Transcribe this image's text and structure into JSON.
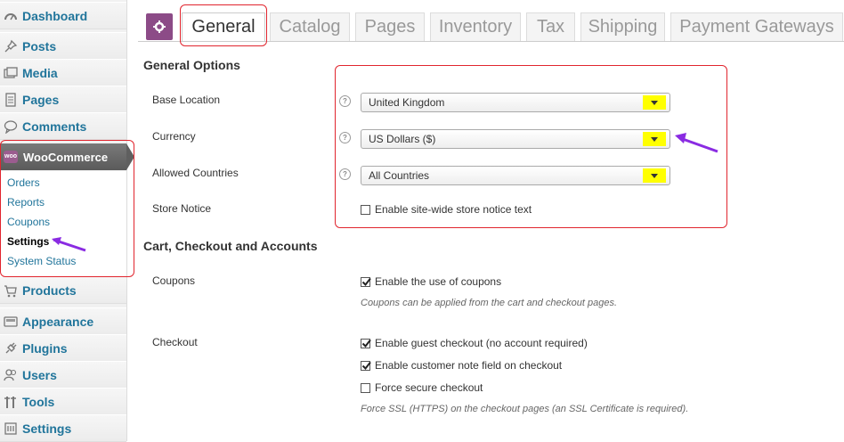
{
  "sidebar": {
    "top_items": [
      {
        "label": "Dashboard",
        "icon": "dashboard-icon"
      },
      {
        "label": "Posts",
        "icon": "pin-icon"
      },
      {
        "label": "Media",
        "icon": "media-icon"
      },
      {
        "label": "Pages",
        "icon": "pages-icon"
      },
      {
        "label": "Comments",
        "icon": "comment-icon"
      }
    ],
    "woocommerce": {
      "label": "WooCommerce",
      "logo_text": "woo",
      "submenu": [
        "Orders",
        "Reports",
        "Coupons",
        "Settings",
        "System Status"
      ],
      "current": "Settings"
    },
    "bottom_items": [
      {
        "label": "Products",
        "icon": "products-icon"
      },
      {
        "label": "Appearance",
        "icon": "appearance-icon"
      },
      {
        "label": "Plugins",
        "icon": "plugin-icon"
      },
      {
        "label": "Users",
        "icon": "users-icon"
      },
      {
        "label": "Tools",
        "icon": "tools-icon"
      },
      {
        "label": "Settings",
        "icon": "settings-icon"
      }
    ]
  },
  "tabs": [
    "General",
    "Catalog",
    "Pages",
    "Inventory",
    "Tax",
    "Shipping",
    "Payment Gateways"
  ],
  "active_tab": "General",
  "general_options": {
    "title": "General Options",
    "base_location": {
      "label": "Base Location",
      "value": "United Kingdom"
    },
    "currency": {
      "label": "Currency",
      "value": "US Dollars ($)"
    },
    "allowed_countries": {
      "label": "Allowed Countries",
      "value": "All Countries"
    },
    "store_notice": {
      "label": "Store Notice",
      "checkbox_label": "Enable site-wide store notice text",
      "checked": false
    }
  },
  "cart_checkout": {
    "title": "Cart, Checkout and Accounts",
    "coupons": {
      "label": "Coupons",
      "checkbox_label": "Enable the use of coupons",
      "checked": true,
      "description": "Coupons can be applied from the cart and checkout pages."
    },
    "checkout": {
      "label": "Checkout",
      "options": [
        {
          "label": "Enable guest checkout (no account required)",
          "checked": true
        },
        {
          "label": "Enable customer note field on checkout",
          "checked": true
        },
        {
          "label": "Force secure checkout",
          "checked": false
        }
      ],
      "description": "Force SSL (HTTPS) on the checkout pages (an SSL Certificate is required)."
    }
  },
  "colors": {
    "link": "#21759b",
    "woo_purple": "#8c4b87",
    "annotation_red": "#e1252e",
    "annotation_arrow": "#8a2be2",
    "select_arrow_highlight": "#ffff00"
  }
}
